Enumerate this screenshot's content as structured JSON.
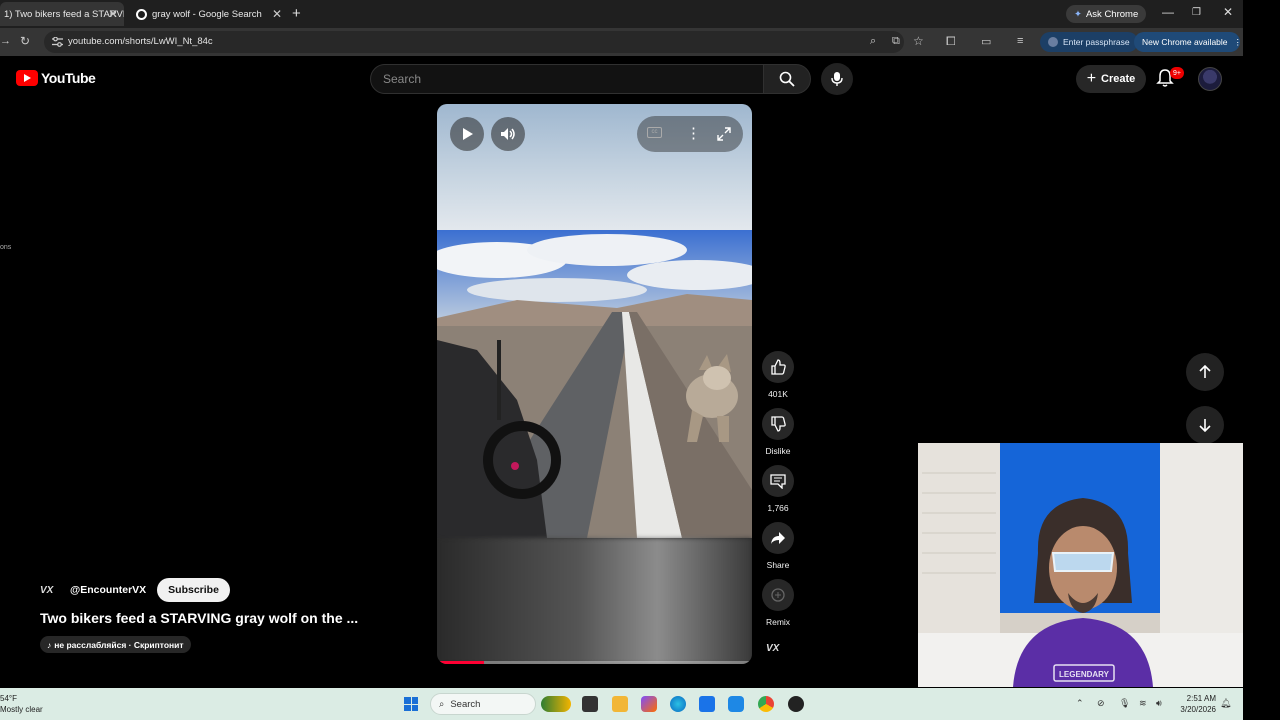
{
  "browser": {
    "tabs": [
      {
        "title": "1) Two bikers feed a STARVING",
        "active": true
      },
      {
        "title": "gray wolf - Google Search",
        "active": false
      }
    ],
    "new_tab": "+",
    "ask_chrome": "Ask Chrome",
    "url": "youtube.com/shorts/LwWI_Nt_84c",
    "passphrase_pill": "Enter passphrase",
    "update_pill": "New Chrome available"
  },
  "youtube": {
    "logo_text": "YouTube",
    "search_placeholder": "Search",
    "create_label": "Create",
    "notifications_badge": "9+",
    "left_edge_text": "ons"
  },
  "short": {
    "progress_fraction": 0.15,
    "actions": {
      "like_count": "401K",
      "dislike_label": "Dislike",
      "comment_count": "1,766",
      "share_label": "Share",
      "remix_label": "Remix"
    },
    "channel_logo": "VX",
    "channel_handle": "@EncounterVX",
    "subscribe_label": "Subscribe",
    "title": "Two bikers feed a STARVING gray wolf on the ...",
    "sound": "не расслабляйся · Скриптонит",
    "webcam_shirt_text": "LEGENDARY"
  },
  "taskbar": {
    "weather_temp": "54°F",
    "weather_desc": "Mostly clear",
    "search_label": "Search",
    "time": "2:51 AM",
    "date": "3/20/2026"
  },
  "colors": {
    "youtube_red": "#ff0000",
    "progress": "#ff0033",
    "update_pill": "#1f4a78",
    "taskbar": "#dbece4"
  }
}
